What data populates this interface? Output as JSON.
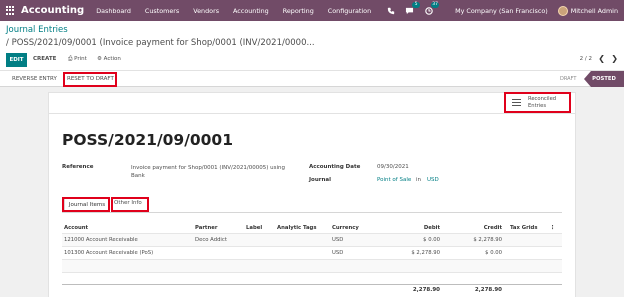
{
  "navbar": {
    "brand": "Accounting",
    "menu": [
      "Dashboard",
      "Customers",
      "Vendors",
      "Accounting",
      "Reporting",
      "Configuration"
    ],
    "messages_badge": "5",
    "activities_badge": "37",
    "company": "My Company (San Francisco)",
    "user": "Mitchell Admin"
  },
  "breadcrumb": {
    "root": "Journal Entries",
    "current": "/ POSS/2021/09/0001 (Invoice payment for Shop/0001 (INV/2021/0000..."
  },
  "toolbar": {
    "edit": "EDIT",
    "create": "CREATE",
    "print": "⎙ Print",
    "action": "⚙ Action",
    "pager": "2 / 2"
  },
  "statusbar": {
    "reverse": "REVERSE ENTRY",
    "reset": "RESET TO DRAFT",
    "draft": "DRAFT",
    "posted": "POSTED"
  },
  "smart_button": {
    "label": "Reconciled Entries"
  },
  "form": {
    "title": "POSS/2021/09/0001",
    "reference_label": "Reference",
    "reference_value": "Invoice payment for Shop/0001 (INV/2021/00005) using Bank",
    "accounting_date_label": "Accounting Date",
    "accounting_date_value": "09/30/2021",
    "journal_label": "Journal",
    "journal_value": "Point of Sale",
    "journal_in": "in",
    "journal_currency": "USD"
  },
  "tabs": {
    "journal_items": "Journal Items",
    "other_info": "Other Info"
  },
  "table": {
    "headers": {
      "account": "Account",
      "partner": "Partner",
      "label": "Label",
      "analytic_tags": "Analytic Tags",
      "currency": "Currency",
      "debit": "Debit",
      "credit": "Credit",
      "tax_grids": "Tax Grids",
      "options": "⋮"
    },
    "rows": [
      {
        "account": "121000 Account Receivable",
        "partner": "Deco Addict",
        "currency": "USD",
        "debit": "$ 0.00",
        "credit": "$ 2,278.90"
      },
      {
        "account": "101300 Account Receivable (PoS)",
        "partner": "",
        "currency": "USD",
        "debit": "$ 2,278.90",
        "credit": "$ 0.00"
      }
    ],
    "totals": {
      "debit": "2,278.90",
      "credit": "2,278.90"
    }
  },
  "colors": {
    "brand": "#714b67",
    "accent": "#017e84",
    "highlight": "#e0001b"
  }
}
